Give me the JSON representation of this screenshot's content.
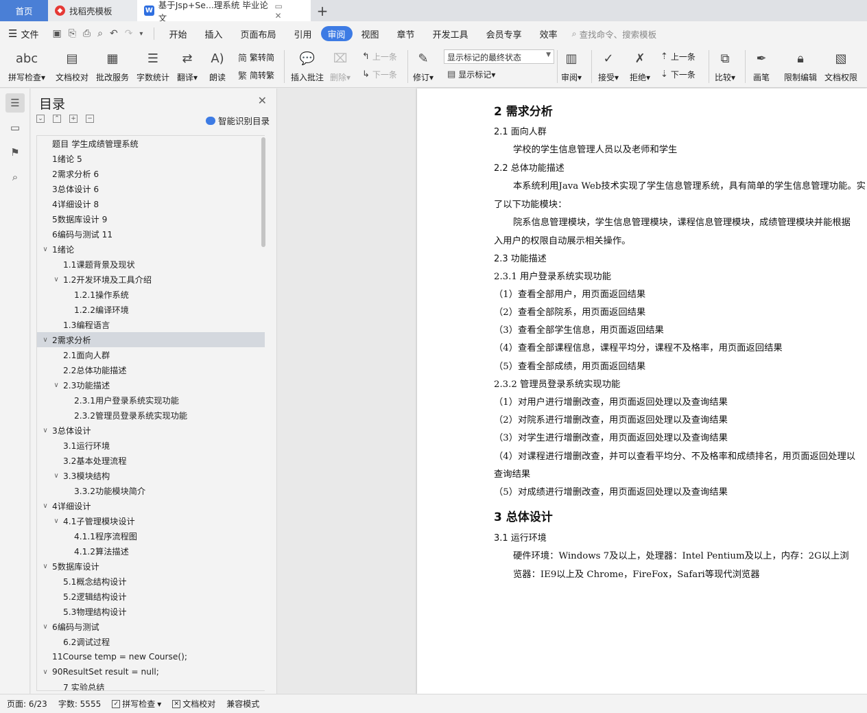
{
  "tabs": {
    "home": "首页",
    "store": "找稻壳模板",
    "doc": "基于Jsp+Se...理系统 毕业论文",
    "new_tab": "+"
  },
  "menu": {
    "file": "文件",
    "items": [
      "开始",
      "插入",
      "页面布局",
      "引用",
      "审阅",
      "视图",
      "章节",
      "开发工具",
      "会员专享",
      "效率"
    ],
    "active_index": 4,
    "search": "查找命令、搜索模板"
  },
  "ribbon": {
    "spell_check": "拼写检查",
    "doc_proof": "文档校对",
    "revise_service": "批改服务",
    "word_count": "字数统计",
    "translate": "翻译",
    "read_aloud": "朗读",
    "trad_to_simp": "繁转简",
    "simp_to_trad": "简转繁",
    "insert_comment": "插入批注",
    "delete": "删除",
    "prev_comment": "上一条",
    "next_comment": "下一条",
    "track_changes": "修订",
    "markup_state": "显示标记的最终状态",
    "show_markup": "显示标记",
    "review": "审阅",
    "accept": "接受",
    "reject": "拒绝",
    "prev_change": "上一条",
    "next_change": "下一条",
    "compare": "比较",
    "pen": "画笔",
    "restrict_edit": "限制编辑",
    "doc_permission": "文档权限"
  },
  "toc": {
    "title": "目录",
    "smart": "智能识别目录",
    "items": [
      {
        "text": "题目  学生成绩管理系统",
        "level": 0,
        "chev": ""
      },
      {
        "text": "1绪论  5",
        "level": 0,
        "chev": ""
      },
      {
        "text": "2需求分析  6",
        "level": 0,
        "chev": ""
      },
      {
        "text": "3总体设计  6",
        "level": 0,
        "chev": ""
      },
      {
        "text": "4详细设计  8",
        "level": 0,
        "chev": ""
      },
      {
        "text": "5数据库设计  9",
        "level": 0,
        "chev": ""
      },
      {
        "text": "6编码与测试  11",
        "level": 0,
        "chev": ""
      },
      {
        "text": "1绪论",
        "level": 0,
        "chev": "v"
      },
      {
        "text": "1.1课题背景及现状",
        "level": 1,
        "chev": ""
      },
      {
        "text": "1.2开发环境及工具介绍",
        "level": 1,
        "chev": "v"
      },
      {
        "text": "1.2.1操作系统",
        "level": 2,
        "chev": ""
      },
      {
        "text": "1.2.2编译环境",
        "level": 2,
        "chev": ""
      },
      {
        "text": "1.3编程语言",
        "level": 1,
        "chev": ""
      },
      {
        "text": "2需求分析",
        "level": 0,
        "chev": "v",
        "selected": true
      },
      {
        "text": "2.1面向人群",
        "level": 1,
        "chev": ""
      },
      {
        "text": "2.2总体功能描述",
        "level": 1,
        "chev": ""
      },
      {
        "text": "2.3功能描述",
        "level": 1,
        "chev": "v"
      },
      {
        "text": "2.3.1用户登录系统实现功能",
        "level": 2,
        "chev": ""
      },
      {
        "text": "2.3.2管理员登录系统实现功能",
        "level": 2,
        "chev": ""
      },
      {
        "text": "3总体设计",
        "level": 0,
        "chev": "v"
      },
      {
        "text": "3.1运行环境",
        "level": 1,
        "chev": ""
      },
      {
        "text": "3.2基本处理流程",
        "level": 1,
        "chev": ""
      },
      {
        "text": "3.3模块结构",
        "level": 1,
        "chev": "v"
      },
      {
        "text": "3.3.2功能模块简介",
        "level": 2,
        "chev": ""
      },
      {
        "text": "4详细设计",
        "level": 0,
        "chev": "v"
      },
      {
        "text": "4.1子管理模块设计",
        "level": 1,
        "chev": "v"
      },
      {
        "text": "4.1.1程序流程图",
        "level": 2,
        "chev": ""
      },
      {
        "text": "4.1.2算法描述",
        "level": 2,
        "chev": ""
      },
      {
        "text": "5数据库设计",
        "level": 0,
        "chev": "v"
      },
      {
        "text": "5.1概念结构设计",
        "level": 1,
        "chev": ""
      },
      {
        "text": "5.2逻辑结构设计",
        "level": 1,
        "chev": ""
      },
      {
        "text": "5.3物理结构设计",
        "level": 1,
        "chev": ""
      },
      {
        "text": "6编码与测试",
        "level": 0,
        "chev": "v"
      },
      {
        "text": "6.2调试过程",
        "level": 1,
        "chev": ""
      },
      {
        "text": "11Course temp = new Course();",
        "level": 0,
        "chev": ""
      },
      {
        "text": "90ResultSet result = null;",
        "level": 0,
        "chev": "v"
      },
      {
        "text": "7 实验总结",
        "level": 1,
        "chev": ""
      }
    ]
  },
  "document": {
    "lines": [
      {
        "text": "2  需求分析",
        "style": "h1"
      },
      {
        "text": "2.1  面向人群",
        "style": "h2"
      },
      {
        "text": "学校的学生信息管理人员以及老师和学生",
        "style": "p",
        "indent": true
      },
      {
        "text": "2.2  总体功能描述",
        "style": "h2"
      },
      {
        "text": "本系统利用Java Web技术实现了学生信息管理系统，具有简单的学生信息管理功能。实",
        "style": "p",
        "indent": true
      },
      {
        "text": "了以下功能模块：",
        "style": "p"
      },
      {
        "text": "院系信息管理模块，学生信息管理模块，课程信息管理模块，成绩管理模块并能根据",
        "style": "p",
        "indent": true
      },
      {
        "text": "入用户的权限自动展示相关操作。",
        "style": "p"
      },
      {
        "text": "2.3  功能描述",
        "style": "h2"
      },
      {
        "text": "2.3.1 用户登录系统实现功能",
        "style": "p"
      },
      {
        "text": "（1）查看全部用户，用页面返回结果",
        "style": "p"
      },
      {
        "text": "（2）查看全部院系，用页面返回结果",
        "style": "p"
      },
      {
        "text": "（3）查看全部学生信息，用页面返回结果",
        "style": "p"
      },
      {
        "text": "（4）查看全部课程信息，课程平均分，课程不及格率，用页面返回结果",
        "style": "p"
      },
      {
        "text": "（5）查看全部成绩，用页面返回结果",
        "style": "p"
      },
      {
        "text": "2.3.2 管理员登录系统实现功能",
        "style": "p"
      },
      {
        "text": "（1）对用户进行增删改查，用页面返回处理以及查询结果",
        "style": "p"
      },
      {
        "text": "（2）对院系进行增删改查，用页面返回处理以及查询结果",
        "style": "p"
      },
      {
        "text": "（3）对学生进行增删改查，用页面返回处理以及查询结果",
        "style": "p"
      },
      {
        "text": "（4）对课程进行增删改查，并可以查看平均分、不及格率和成绩排名，用页面返回处理以",
        "style": "p"
      },
      {
        "text": "查询结果",
        "style": "p"
      },
      {
        "text": "（5）对成绩进行增删改查，用页面返回处理以及查询结果",
        "style": "p"
      },
      {
        "text": "3  总体设计",
        "style": "h1"
      },
      {
        "text": "3.1  运行环境",
        "style": "h2"
      },
      {
        "text": "硬件环境：Windows 7及以上，处理器：Intel Pentium及以上，内存：2G以上浏",
        "style": "p",
        "indent": true
      },
      {
        "text": "览器：IE9以上及 Chrome，FireFox，Safari等现代浏览器",
        "style": "p",
        "indent": true
      }
    ]
  },
  "status": {
    "page": "页面: 6/23",
    "words": "字数: 5555",
    "spell": "拼写检查",
    "proof": "文档校对",
    "compat": "兼容模式"
  }
}
